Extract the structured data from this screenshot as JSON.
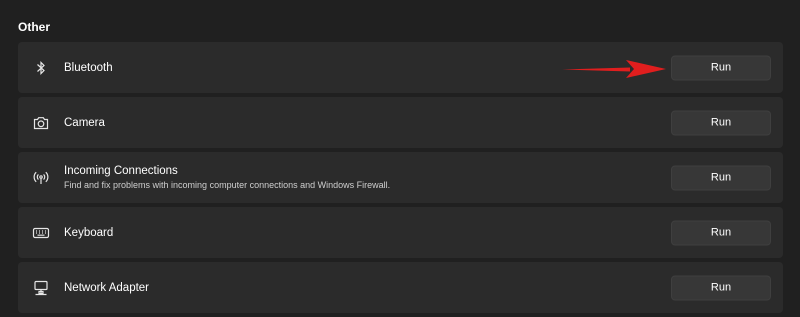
{
  "section": {
    "title": "Other"
  },
  "items": [
    {
      "label": "Bluetooth",
      "description": "",
      "icon": "bluetooth-icon",
      "button": "Run"
    },
    {
      "label": "Camera",
      "description": "",
      "icon": "camera-icon",
      "button": "Run"
    },
    {
      "label": "Incoming Connections",
      "description": "Find and fix problems with incoming computer connections and Windows Firewall.",
      "icon": "wireless-icon",
      "button": "Run"
    },
    {
      "label": "Keyboard",
      "description": "",
      "icon": "keyboard-icon",
      "button": "Run"
    },
    {
      "label": "Network Adapter",
      "description": "",
      "icon": "network-adapter-icon",
      "button": "Run"
    }
  ],
  "annotation": {
    "color": "#e01e1e",
    "icon": "red-arrow-icon"
  }
}
